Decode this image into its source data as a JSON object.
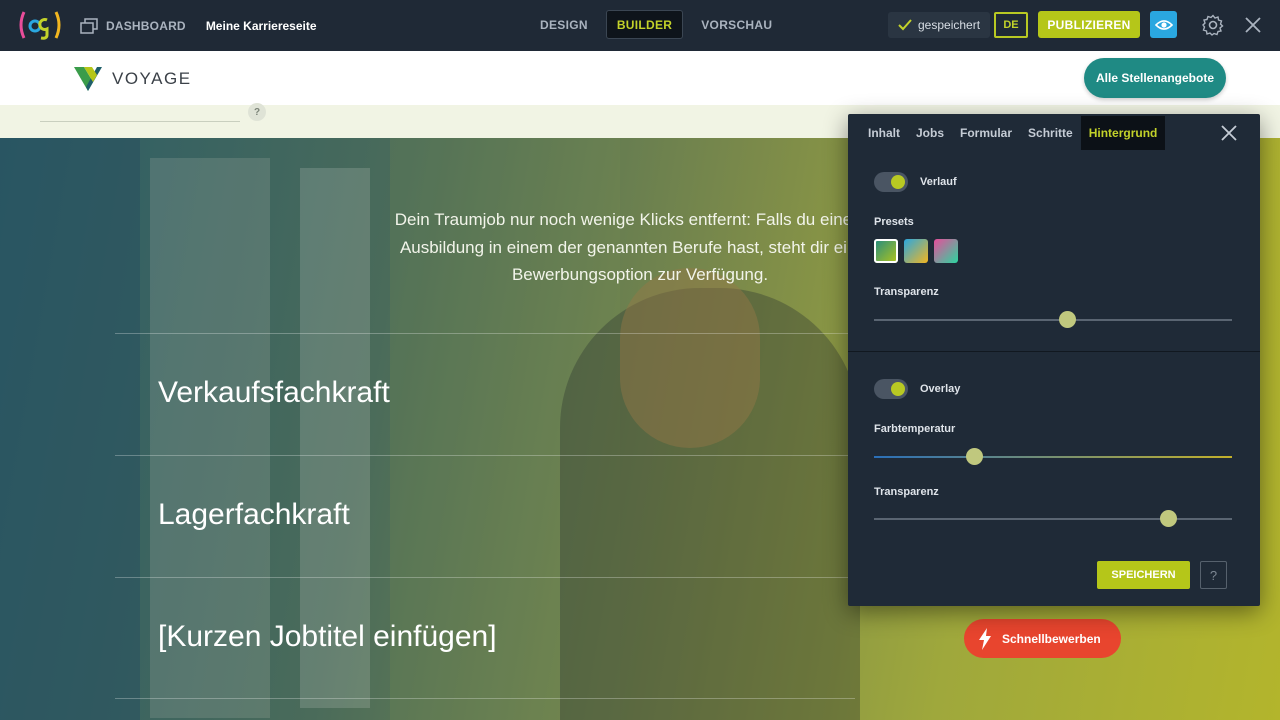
{
  "topbar": {
    "dashboard_label": "DASHBOARD",
    "page_name": "Meine Karriereseite",
    "modes": [
      "DESIGN",
      "BUILDER",
      "VORSCHAU"
    ],
    "active_mode": "BUILDER",
    "saved_label": "gespeichert",
    "language": "DE",
    "publish_label": "PUBLIZIEREN"
  },
  "site": {
    "brand": "VOYAGE",
    "all_jobs_label": "Alle Stellenangebote",
    "help_mark": "?",
    "intro_text": "Dein Traumjob nur noch wenige Klicks entfernt: Falls du eine abg... Ausbildung in einem der genannten Berufe hast, steht dir eine u... Bewerbungsoption zur Verfügung.",
    "intro_lines": [
      "Dein Traumjob nur noch wenige Klicks entfernt: Falls du eine abg",
      "Ausbildung in einem der genannten Berufe hast, steht dir eine u",
      "Bewerbungsoption zur Verfügung."
    ],
    "jobs": [
      "Verkaufsfachkraft",
      "Lagerfachkraft",
      "[Kurzen Jobtitel einfügen]"
    ],
    "quick_apply_label": "Schnellbewerben"
  },
  "panel": {
    "tabs": [
      "Inhalt",
      "Jobs",
      "Formular",
      "Schritte",
      "Hintergrund"
    ],
    "active_tab": "Hintergrund",
    "gradient_toggle_label": "Verlauf",
    "gradient_enabled": true,
    "presets_label": "Presets",
    "gradient_transparency_label": "Transparenz",
    "gradient_transparency_value": 0.54,
    "overlay_toggle_label": "Overlay",
    "overlay_enabled": true,
    "color_temperature_label": "Farbtemperatur",
    "color_temperature_value": 0.28,
    "overlay_transparency_label": "Transparenz",
    "overlay_transparency_value": 0.82,
    "save_label": "SPEICHERN",
    "help_label": "?"
  },
  "colors": {
    "accent": "#b5c619",
    "teal_button": "#1f8a84",
    "quick_apply": "#e8452e",
    "info_blue": "#2aa7e0"
  }
}
